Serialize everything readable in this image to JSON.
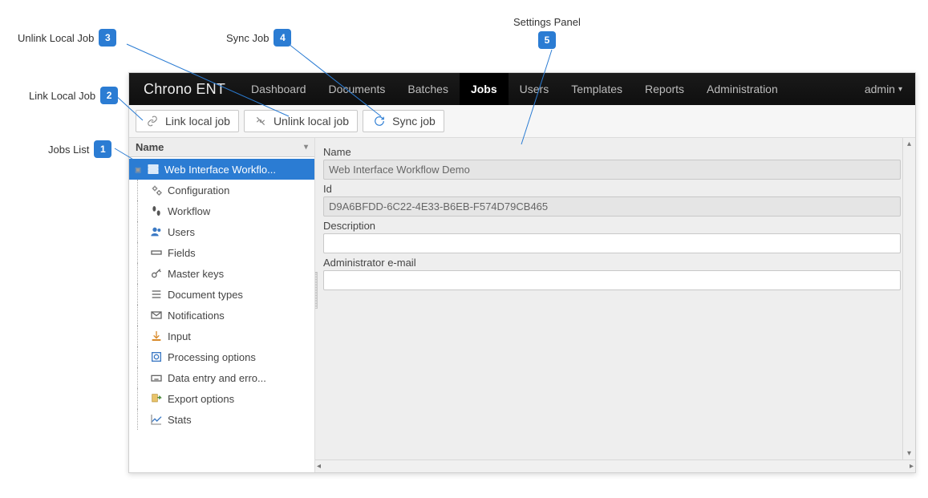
{
  "annotations": {
    "a1": {
      "num": "1",
      "label": "Jobs List"
    },
    "a2": {
      "num": "2",
      "label": "Link Local Job"
    },
    "a3": {
      "num": "3",
      "label": "Unlink Local Job"
    },
    "a4": {
      "num": "4",
      "label": "Sync Job"
    },
    "a5": {
      "num": "5",
      "label": "Settings Panel"
    }
  },
  "brand": "Chrono ENT",
  "nav": {
    "dashboard": "Dashboard",
    "documents": "Documents",
    "batches": "Batches",
    "jobs": "Jobs",
    "users": "Users",
    "templates": "Templates",
    "reports": "Reports",
    "administration": "Administration"
  },
  "user_menu": "admin",
  "toolbar": {
    "link": "Link local job",
    "unlink": "Unlink local job",
    "sync": "Sync job"
  },
  "sidebar": {
    "header": "Name",
    "root": "Web Interface Workflo...",
    "items": [
      "Configuration",
      "Workflow",
      "Users",
      "Fields",
      "Master keys",
      "Document types",
      "Notifications",
      "Input",
      "Processing options",
      "Data entry and erro...",
      "Export options",
      "Stats"
    ]
  },
  "settings": {
    "name_label": "Name",
    "name_value": "Web Interface Workflow Demo",
    "id_label": "Id",
    "id_value": "D9A6BFDD-6C22-4E33-B6EB-F574D79CB465",
    "description_label": "Description",
    "description_value": "",
    "admin_email_label": "Administrator e-mail",
    "admin_email_value": ""
  }
}
